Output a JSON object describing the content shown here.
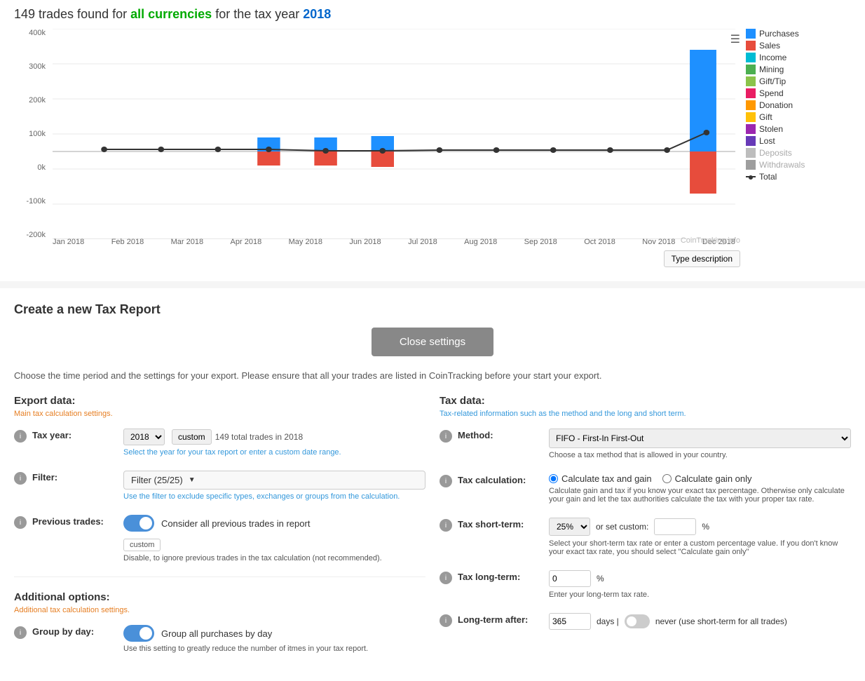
{
  "page": {
    "title_prefix": "149 trades found for ",
    "title_highlight1": "all currencies",
    "title_middle": " for the tax year ",
    "title_highlight2": "2018"
  },
  "chart": {
    "menu_icon": "☰",
    "y_axis_labels": [
      "400k",
      "300k",
      "200k",
      "100k",
      "0k",
      "-100k",
      "-200k"
    ],
    "x_axis_labels": [
      "Jan 2018",
      "Feb 2018",
      "Mar 2018",
      "Apr 2018",
      "May 2018",
      "Jun 2018",
      "Jul 2018",
      "Aug 2018",
      "Sep 2018",
      "Oct 2018",
      "Nov 2018",
      "Dec 2018"
    ],
    "legend": [
      {
        "label": "Purchases",
        "color": "#1e90ff"
      },
      {
        "label": "Sales",
        "color": "#e74c3c"
      },
      {
        "label": "Income",
        "color": "#00bcd4"
      },
      {
        "label": "Mining",
        "color": "#4caf50"
      },
      {
        "label": "Gift/Tip",
        "color": "#8bc34a"
      },
      {
        "label": "Spend",
        "color": "#e91e63"
      },
      {
        "label": "Donation",
        "color": "#ff9800"
      },
      {
        "label": "Gift",
        "color": "#ffc107"
      },
      {
        "label": "Stolen",
        "color": "#9c27b0"
      },
      {
        "label": "Lost",
        "color": "#673ab7"
      },
      {
        "label": "Deposits",
        "color": "#bdbdbd"
      },
      {
        "label": "Withdrawals",
        "color": "#9e9e9e"
      },
      {
        "label": "Total",
        "color": "#333",
        "is_line": true
      }
    ],
    "cointracking": "CoinTracking.info",
    "type_desc_btn": "Type description"
  },
  "settings": {
    "title": "Create a new Tax Report",
    "close_btn": "Close settings",
    "description": "Choose the time period and the settings for your export. Please ensure that all your trades are listed in CoinTracking before your start your export.",
    "export_section": {
      "header": "Export data:",
      "subtitle": "Main tax calculation settings.",
      "tax_year_label": "Tax year:",
      "tax_year_value": "2018",
      "custom_btn": "custom",
      "trade_count": "149 total trades in 2018",
      "tax_year_help": "Select the year for your tax report or enter a custom date range.",
      "filter_label": "Filter:",
      "filter_value": "Filter (25/25)",
      "filter_help": "Use the filter to exclude specific types, exchanges or groups from the calculation.",
      "prev_trades_label": "Previous trades:",
      "prev_trades_toggle": "Consider all previous trades in report",
      "prev_trades_custom": "custom",
      "prev_trades_help": "Disable, to ignore previous trades in the tax calculation (not recommended)."
    },
    "tax_section": {
      "header": "Tax data:",
      "subtitle": "Tax-related information such as the method and the long and short term.",
      "method_label": "Method:",
      "method_value": "FIFO - First-In First-Out",
      "method_help": "Choose a tax method that is allowed in your country.",
      "tax_calc_label": "Tax calculation:",
      "calc_option1": "Calculate tax and gain",
      "calc_option2": "Calculate gain only",
      "calc_help": "Calculate gain and tax if you know your exact tax percentage. Otherwise only calculate your gain and let the tax authorities calculate the tax with your proper tax rate.",
      "short_term_label": "Tax short-term:",
      "short_term_value": "25%",
      "custom_percent_label": "or set custom:",
      "short_term_help": "Select your short-term tax rate or enter a custom percentage value. If you don't know your exact tax rate, you should select \"Calculate gain only\"",
      "long_term_label": "Tax long-term:",
      "long_term_value": "0",
      "long_term_percent": "%",
      "long_term_help": "Enter your long-term tax rate.",
      "longterm_after_label": "Long-term after:",
      "days_value": "365",
      "days_label": "days |",
      "never_label": "never (use short-term for all trades)"
    },
    "additional_section": {
      "header": "Additional options:",
      "subtitle": "Additional tax calculation settings.",
      "group_by_day_label": "Group by day:",
      "group_by_day_toggle": "Group all purchases by day",
      "group_by_day_help": "Use this setting to greatly reduce the number of itmes in your tax report."
    }
  }
}
